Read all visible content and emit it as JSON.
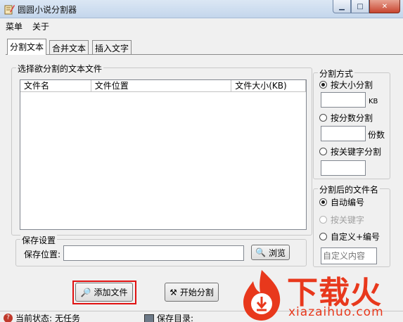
{
  "window": {
    "title": "圆圆小说分割器"
  },
  "menu": [
    "菜单",
    "关于"
  ],
  "tabs": [
    "分割文本",
    "合并文本",
    "插入文字"
  ],
  "file_group": {
    "legend": "选择欲分割的文本文件",
    "columns": [
      "文件名",
      "文件位置",
      "文件大小(KB)"
    ]
  },
  "split_mode": {
    "legend": "分割方式",
    "options": [
      {
        "label": "按大小分割",
        "checked": true,
        "unit": "KB"
      },
      {
        "label": "按分数分割",
        "checked": false,
        "unit": "份数"
      },
      {
        "label": "按关键字分割",
        "checked": false,
        "unit": ""
      }
    ]
  },
  "naming": {
    "legend": "分割后的文件名",
    "options": [
      {
        "label": "自动编号",
        "checked": true,
        "disabled": false
      },
      {
        "label": "按关键字",
        "checked": false,
        "disabled": true
      },
      {
        "label": "自定义+编号",
        "checked": false,
        "disabled": false
      }
    ],
    "custom_placeholder": "自定义内容"
  },
  "save": {
    "legend": "保存设置",
    "location_label": "保存位置:",
    "browse_label": "浏览"
  },
  "actions": {
    "add_file": "添加文件",
    "start_split": "开始分割"
  },
  "status": {
    "state_label": "当前状态:",
    "state_value": "无任务",
    "dir_label": "保存目录:"
  },
  "watermark": {
    "text": "下载火",
    "sub": "xiazaihuo.com"
  },
  "colors": {
    "accent_red": "#e01010",
    "watermark_red": "#e8381c"
  }
}
